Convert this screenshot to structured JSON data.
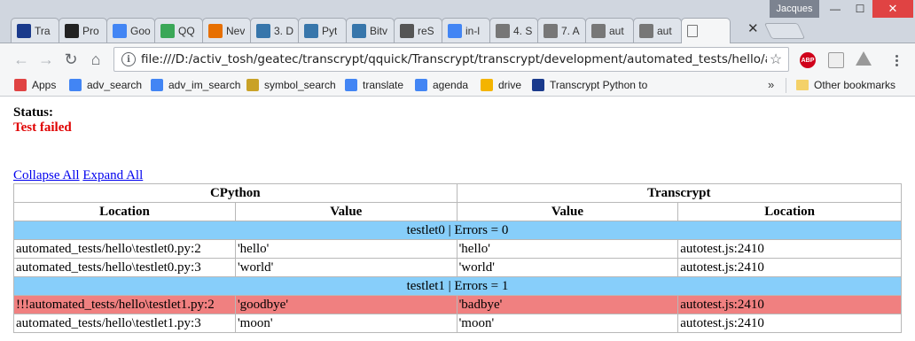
{
  "window": {
    "profile": "Jacques",
    "min_glyph": "—",
    "max_glyph": "☐",
    "close_glyph": "✕"
  },
  "tabs": [
    {
      "title": "Tra",
      "icon": "transcrypt-icon",
      "icon_color": "#1a3a8c"
    },
    {
      "title": "Pro",
      "icon": "github-icon",
      "icon_color": "#222222"
    },
    {
      "title": "Goo",
      "icon": "google-translate-icon",
      "icon_color": "#4285f4"
    },
    {
      "title": "QQ",
      "icon": "qq-icon",
      "icon_color": "#3aa757"
    },
    {
      "title": "Nev",
      "icon": "java-icon",
      "icon_color": "#e76f00"
    },
    {
      "title": "3. D",
      "icon": "python-icon",
      "icon_color": "#3776ab"
    },
    {
      "title": "Pyt",
      "icon": "python-org-icon",
      "icon_color": "#3776ab"
    },
    {
      "title": "Bitv",
      "icon": "python-icon",
      "icon_color": "#3776ab"
    },
    {
      "title": "reS",
      "icon": "rest-icon",
      "icon_color": "#555555"
    },
    {
      "title": "in-l",
      "icon": "google-icon",
      "icon_color": "#4285f4"
    },
    {
      "title": "4. S",
      "icon": "document-icon",
      "icon_color": "#777777"
    },
    {
      "title": "7. A",
      "icon": "document-icon",
      "icon_color": "#777777"
    },
    {
      "title": "aut",
      "icon": "document-icon",
      "icon_color": "#777777"
    },
    {
      "title": "aut",
      "icon": "document-icon",
      "icon_color": "#777777"
    },
    {
      "title": "",
      "icon": "document-icon",
      "icon_color": "#777777",
      "active": true
    }
  ],
  "tab_close": "✕",
  "toolbar": {
    "back": "←",
    "forward": "→",
    "reload": "↻",
    "home": "⌂",
    "info": "i",
    "url": "file:///D:/activ_tosh/geatec/transcrypt/qquick/Transcrypt/transcrypt/development/automated_tests/hello/autotest.h",
    "star": "☆",
    "abp": "ABP"
  },
  "bookmarks": [
    {
      "label": "Apps",
      "icon": "apps-grid-icon",
      "icon_color": "#e04343"
    },
    {
      "label": "adv_search",
      "icon": "google-icon",
      "icon_color": "#4285f4"
    },
    {
      "label": "adv_im_search",
      "icon": "google-icon",
      "icon_color": "#4285f4"
    },
    {
      "label": "symbol_search",
      "icon": "symbol-icon",
      "icon_color": "#c9a227"
    },
    {
      "label": "translate",
      "icon": "google-translate-icon",
      "icon_color": "#4285f4"
    },
    {
      "label": "agenda",
      "icon": "calendar-icon",
      "icon_color": "#4285f4"
    },
    {
      "label": "drive",
      "icon": "drive-icon",
      "icon_color": "#f4b400"
    },
    {
      "label": "Transcrypt Python to",
      "icon": "transcrypt-icon",
      "icon_color": "#1a3a8c"
    }
  ],
  "bookmarks_more": "»",
  "other_bookmarks": "Other bookmarks",
  "page": {
    "status_label": "Status:",
    "status_value": "Test failed",
    "collapse_all": "Collapse All",
    "expand_all": "Expand All",
    "table": {
      "group_headers": [
        "CPython",
        "Transcrypt"
      ],
      "column_headers": [
        "Location",
        "Value",
        "Value",
        "Location"
      ],
      "sections": [
        {
          "title": "testlet0 | Errors = 0",
          "rows": [
            {
              "failed": false,
              "cells": [
                "automated_tests/hello\\testlet0.py:2",
                "'hello'",
                "'hello'",
                "autotest.js:2410"
              ]
            },
            {
              "failed": false,
              "cells": [
                "automated_tests/hello\\testlet0.py:3",
                "'world'",
                "'world'",
                "autotest.js:2410"
              ]
            }
          ]
        },
        {
          "title": "testlet1 | Errors = 1",
          "rows": [
            {
              "failed": true,
              "cells": [
                "!!!automated_tests/hello\\testlet1.py:2",
                "'goodbye'",
                "'badbye'",
                "autotest.js:2410"
              ]
            },
            {
              "failed": false,
              "cells": [
                "automated_tests/hello\\testlet1.py:3",
                "'moon'",
                "'moon'",
                "autotest.js:2410"
              ]
            }
          ]
        }
      ]
    }
  }
}
